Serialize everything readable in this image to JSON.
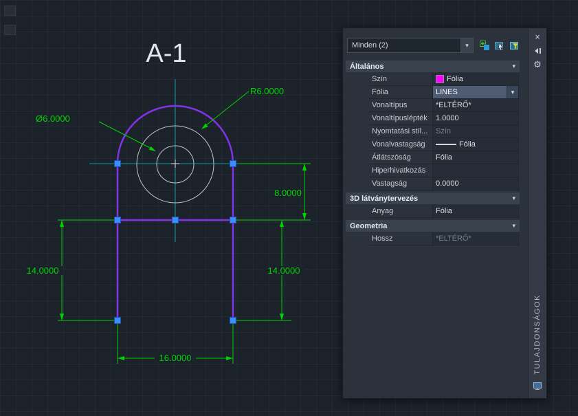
{
  "colors": {
    "canvas-bg": "#1c222a",
    "grid-line": "#242b34",
    "shape-purple": "#8232e8",
    "dim-green": "#00d400",
    "crosshair-cyan": "#0e9898",
    "grip-fill": "#3c8dff",
    "circle-gray": "#c2c7cd",
    "swatch-magenta": "#ff00ff",
    "palette-bg": "#2b323c",
    "section-bg": "#3a424e",
    "selected-bg": "#4d5b73",
    "dim-green-hex": "#00d400"
  },
  "icons": {
    "close": "×",
    "gear": "⚙",
    "chevron_down": "▾",
    "collapse_section": "▾"
  },
  "drawing": {
    "title": "A-1",
    "dims": {
      "radius": "R6.0000",
      "diameter": "Ø6.0000",
      "height_upper": "8.0000",
      "height_left": "14.0000",
      "height_right": "14.0000",
      "width_bottom": "16.0000"
    }
  },
  "palette": {
    "selection_label": "Minden (2)",
    "vertical_title": "TULAJDONSÁGOK",
    "sections": [
      {
        "title": "Általános",
        "rows": [
          {
            "label": "Szín",
            "value": "Fólia"
          },
          {
            "label": "Fólia",
            "value": "LINES"
          },
          {
            "label": "Vonaltípus",
            "value": "*ELTÉRŐ*"
          },
          {
            "label": "Vonaltípuslépték",
            "value": "1.0000"
          },
          {
            "label": "Nyomtatási stíl...",
            "value": "Szín"
          },
          {
            "label": "Vonalvastagság",
            "value": "Fólia"
          },
          {
            "label": "Átlátszóság",
            "value": "Fólia"
          },
          {
            "label": "Hiperhivatkozás",
            "value": ""
          },
          {
            "label": "Vastagság",
            "value": "0.0000"
          }
        ]
      },
      {
        "title": "3D látványtervezés",
        "rows": [
          {
            "label": "Anyag",
            "value": "Fólia"
          }
        ]
      },
      {
        "title": "Geometria",
        "rows": [
          {
            "label": "Hossz",
            "value": "*ELTÉRŐ*"
          }
        ]
      }
    ]
  }
}
